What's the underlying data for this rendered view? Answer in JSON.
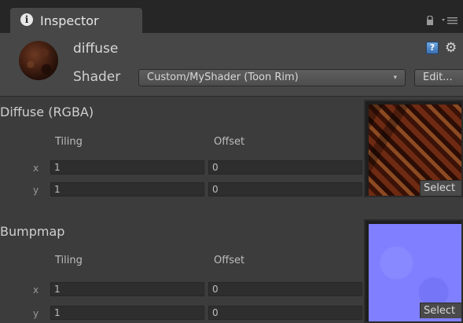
{
  "tab": {
    "title": "Inspector",
    "icon": "info-icon"
  },
  "material": {
    "name": "diffuse",
    "shader_label": "Shader",
    "shader_value": "Custom/MyShader (Toon Rim)",
    "edit_label": "Edit..."
  },
  "properties": [
    {
      "title": "Diffuse (RGBA)",
      "tiling_label": "Tiling",
      "offset_label": "Offset",
      "x_label": "x",
      "y_label": "y",
      "tiling_x": "1",
      "tiling_y": "1",
      "offset_x": "0",
      "offset_y": "0",
      "select_label": "Select"
    },
    {
      "title": "Bumpmap",
      "tiling_label": "Tiling",
      "offset_label": "Offset",
      "x_label": "x",
      "y_label": "y",
      "tiling_x": "1",
      "tiling_y": "1",
      "offset_x": "0",
      "offset_y": "0",
      "select_label": "Select"
    }
  ]
}
